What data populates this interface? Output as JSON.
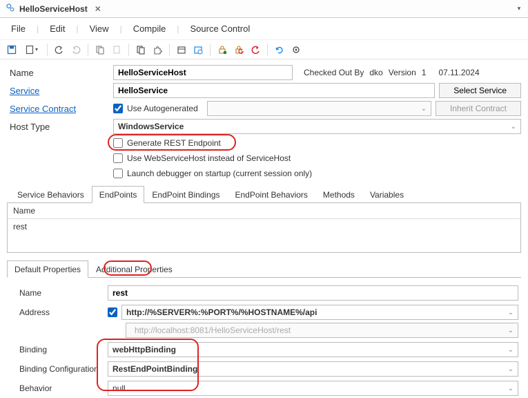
{
  "window": {
    "tabTitle": "HelloServiceHost"
  },
  "menu": {
    "file": "File",
    "edit": "Edit",
    "view": "View",
    "compile": "Compile",
    "sourceControl": "Source Control"
  },
  "form": {
    "nameLabel": "Name",
    "nameValue": "HelloServiceHost",
    "checkedOutLabel": "Checked Out By",
    "checkedOutUser": "dko",
    "versionLabel": "Version",
    "versionValue": "1",
    "versionDate": "07.11.2024",
    "serviceLabel": "Service",
    "serviceValue": "HelloService",
    "selectServiceBtn": "Select Service",
    "contractLabel": "Service Contract",
    "useAutogenLabel": "Use Autogenerated",
    "inheritContractBtn": "Inherit Contract",
    "hostTypeLabel": "Host Type",
    "hostTypeValue": "WindowsService",
    "genRestLabel": "Generate REST Endpoint",
    "useWebHostLabel": "Use WebServiceHost instead of ServiceHost",
    "launchDbgLabel": "Launch debugger on startup (current session only)"
  },
  "subtabs": {
    "serviceBehaviors": "Service Behaviors",
    "endpoints": "EndPoints",
    "endpointBindings": "EndPoint Bindings",
    "endpointBehaviors": "EndPoint Behaviors",
    "methods": "Methods",
    "variables": "Variables"
  },
  "grid": {
    "header": "Name",
    "rows": [
      "rest"
    ]
  },
  "proptabs": {
    "default": "Default Properties",
    "additional": "Additional Properties"
  },
  "props": {
    "nameLabel": "Name",
    "nameValue": "rest",
    "addressLabel": "Address",
    "addressValue": "http://%SERVER%:%PORT%/%HOSTNAME%/api",
    "addressHint": "http://localhost:8081/HelloServiceHost/rest",
    "bindingLabel": "Binding",
    "bindingValue": "webHttpBinding",
    "bindingCfgLabel": "Binding Configuration",
    "bindingCfgValue": "RestEndPointBinding",
    "behaviorLabel": "Behavior",
    "behaviorValue": "null"
  }
}
